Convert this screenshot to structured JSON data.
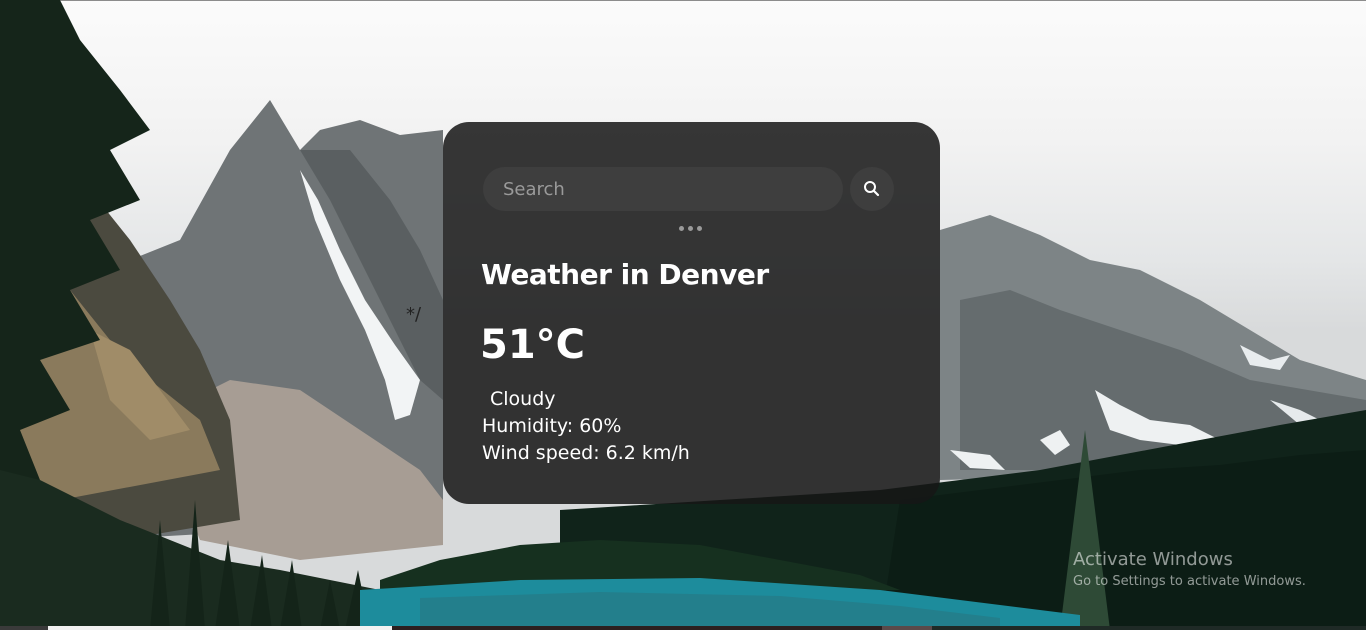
{
  "search": {
    "placeholder": "Search",
    "value": "",
    "button_icon": "search-icon"
  },
  "weather": {
    "title": "Weather in Denver",
    "temperature": "51°C",
    "description": "Cloudy",
    "humidity": "Humidity: 60%",
    "wind": "Wind speed: 6.2 km/h"
  },
  "page": {
    "stray_text": "*/"
  },
  "watermark": {
    "title": "Activate Windows",
    "subtitle": "Go to Settings to activate Windows."
  },
  "colors": {
    "card_background": "#161616",
    "input_background": "#3e3e3e",
    "text": "#ffffff",
    "lake": "#1d8c9c",
    "forest": "#0f2416"
  }
}
